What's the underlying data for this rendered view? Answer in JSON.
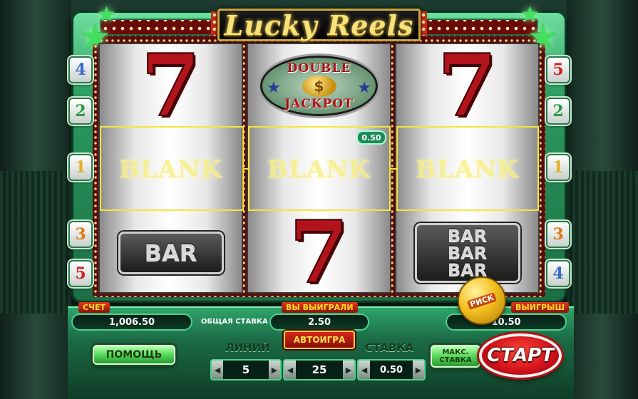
{
  "logo": {
    "title": "Lucky Reels"
  },
  "reels": [
    {
      "top": {
        "type": "seven",
        "label": "7"
      },
      "middle": {
        "type": "blank",
        "label": "BLANK"
      },
      "bottom": {
        "type": "bar",
        "label": "BAR"
      }
    },
    {
      "top": {
        "type": "double-jackpot",
        "line1": "DOUBLE",
        "line2": "JACKPOT",
        "coin": "$"
      },
      "middle": {
        "type": "blank",
        "label": "BLANK"
      },
      "bottom": {
        "type": "seven",
        "label": "7"
      }
    },
    {
      "top": {
        "type": "seven",
        "label": "7"
      },
      "middle": {
        "type": "blank",
        "label": "BLANK"
      },
      "bottom": {
        "type": "triple-bar",
        "label": "BAR",
        "label2": "BAR",
        "label3": "BAR"
      }
    }
  ],
  "payline": {
    "win_value": "0.50"
  },
  "line_badges": {
    "left": [
      {
        "num": "4",
        "color": "#3a6ad0"
      },
      {
        "num": "2",
        "color": "#2a9a40"
      },
      {
        "num": "1",
        "color": "#e0b020"
      },
      {
        "num": "3",
        "color": "#e07a10"
      },
      {
        "num": "5",
        "color": "#d02020"
      }
    ],
    "right": [
      {
        "num": "5",
        "color": "#d02020"
      },
      {
        "num": "2",
        "color": "#2a9a40"
      },
      {
        "num": "1",
        "color": "#e0b020"
      },
      {
        "num": "3",
        "color": "#e07a10"
      },
      {
        "num": "4",
        "color": "#3a6ad0"
      }
    ]
  },
  "console": {
    "balance_label": "СЧЕТ",
    "balance_value": "1,006.50",
    "total_bet_label": "ОБЩАЯ СТАВКА",
    "won_label": "ВЫ ВЫИГРАЛИ",
    "won_value": "2.50",
    "win_label": "ВЫИГРЫШ",
    "win_value": "10.50",
    "risk_label": "РИСК",
    "help_label": "ПОМОЩЬ",
    "autoplay_label": "АВТОИГРА",
    "lines_title": "ЛИНИЙ",
    "bet_title": "СТАВКА",
    "lines_value": "5",
    "coins_value": "25",
    "bet_value": "0.50",
    "max_bet_label_1": "МАКС.",
    "max_bet_label_2": "СТАВКА",
    "start_label": "СТАРТ"
  },
  "icons": {
    "arrow_left": "◀",
    "arrow_right": "▶",
    "star": "★"
  }
}
